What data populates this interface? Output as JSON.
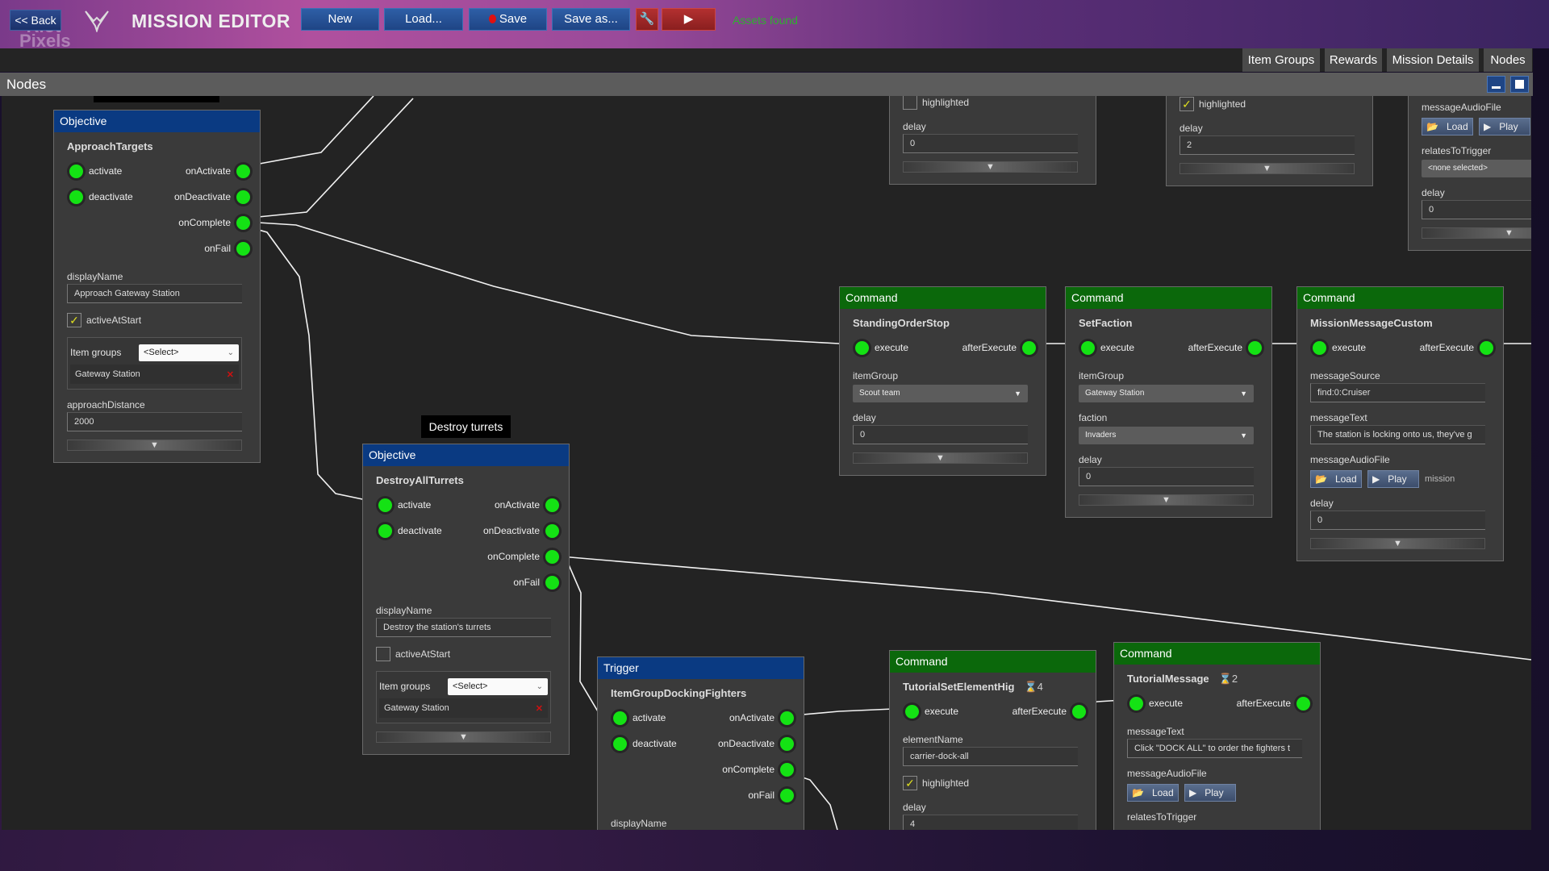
{
  "topbar": {
    "back_label": "<< Back",
    "watermark": "Riot Pixels",
    "title": "MISSION EDITOR",
    "buttons": {
      "new": "New",
      "load": "Load...",
      "save": "Save",
      "save_as": "Save as..."
    },
    "status": "Assets found",
    "status_color": "#2fb02f",
    "icons": {
      "logo": "wings-emblem-icon",
      "tools": "wrench-icon",
      "run": "play-icon",
      "save_dot": "red-dot-icon"
    }
  },
  "tabs": [
    "Item Groups",
    "Rewards",
    "Mission Details",
    "Nodes"
  ],
  "panel": {
    "title": "Nodes"
  },
  "tooltip": "Destroy turrets",
  "colors": {
    "objective_header": "#0a3a82",
    "command_header": "#0b680b",
    "port": "#14e214"
  },
  "nodes": [
    {
      "category": "Objective",
      "name": "ApproachTargets",
      "inputs": [
        "activate",
        "deactivate"
      ],
      "outputs": [
        "onActivate",
        "onDeactivate",
        "onComplete",
        "onFail"
      ],
      "fields": [
        {
          "kind": "text",
          "label": "displayName",
          "value": "Approach Gateway Station"
        },
        {
          "kind": "checkbox",
          "label": "activeAtStart",
          "checked": true
        },
        {
          "kind": "itemgroups",
          "label": "Item groups",
          "select": "<Select>",
          "items": [
            "Gateway Station"
          ]
        },
        {
          "kind": "text",
          "label": "approachDistance",
          "value": "2000"
        },
        {
          "kind": "expand"
        }
      ]
    },
    {
      "category": "Objective",
      "name": "DestroyAllTurrets",
      "inputs": [
        "activate",
        "deactivate"
      ],
      "outputs": [
        "onActivate",
        "onDeactivate",
        "onComplete",
        "onFail"
      ],
      "fields": [
        {
          "kind": "text",
          "label": "displayName",
          "value": "Destroy the station's turrets"
        },
        {
          "kind": "checkbox",
          "label": "activeAtStart",
          "checked": false
        },
        {
          "kind": "itemgroups",
          "label": "Item groups",
          "select": "<Select>",
          "items": [
            "Gateway Station"
          ]
        },
        {
          "kind": "expand"
        }
      ]
    },
    {
      "category": "Trigger",
      "name": "ItemGroupDockingFighters",
      "inputs": [
        "activate",
        "deactivate"
      ],
      "outputs": [
        "onActivate",
        "onDeactivate",
        "onComplete",
        "onFail"
      ],
      "fields": [
        {
          "kind": "label",
          "label": "displayName"
        }
      ]
    },
    {
      "category": "Command",
      "name": "StandingOrderStop",
      "inputs": [
        "execute"
      ],
      "outputs": [
        "afterExecute"
      ],
      "fields": [
        {
          "kind": "select",
          "label": "itemGroup",
          "value": "Scout team"
        },
        {
          "kind": "text",
          "label": "delay",
          "value": "0"
        },
        {
          "kind": "expand"
        }
      ]
    },
    {
      "category": "Command",
      "name": "SetFaction",
      "inputs": [
        "execute"
      ],
      "outputs": [
        "afterExecute"
      ],
      "fields": [
        {
          "kind": "select",
          "label": "itemGroup",
          "value": "Gateway Station"
        },
        {
          "kind": "select",
          "label": "faction",
          "value": "Invaders"
        },
        {
          "kind": "text",
          "label": "delay",
          "value": "0"
        },
        {
          "kind": "expand"
        }
      ]
    },
    {
      "category": "Command",
      "name": "MissionMessageCustom",
      "inputs": [
        "execute"
      ],
      "outputs": [
        "afterExecute"
      ],
      "fields": [
        {
          "kind": "text",
          "label": "messageSource",
          "value": "find:0:Cruiser"
        },
        {
          "kind": "text",
          "label": "messageText",
          "value": "The station is locking onto us, they've g"
        },
        {
          "kind": "audio",
          "label": "messageAudioFile",
          "load": "Load",
          "play": "Play",
          "extra": "mission"
        },
        {
          "kind": "text",
          "label": "delay",
          "value": "0"
        },
        {
          "kind": "expand"
        }
      ]
    },
    {
      "category": "Command",
      "name": "TutorialSetElementHig",
      "badge": "4",
      "inputs": [
        "execute"
      ],
      "outputs": [
        "afterExecute"
      ],
      "fields": [
        {
          "kind": "text",
          "label": "elementName",
          "value": "carrier-dock-all"
        },
        {
          "kind": "checkbox",
          "label": "highlighted",
          "checked": true
        },
        {
          "kind": "text",
          "label": "delay",
          "value": "4"
        }
      ]
    },
    {
      "category": "Command",
      "name": "TutorialMessage",
      "badge": "2",
      "inputs": [
        "execute"
      ],
      "outputs": [
        "afterExecute"
      ],
      "fields": [
        {
          "kind": "text",
          "label": "messageText",
          "value": "Click \"DOCK ALL\" to order the fighters t"
        },
        {
          "kind": "audio",
          "label": "messageAudioFile",
          "load": "Load",
          "play": "Play"
        },
        {
          "kind": "label",
          "label": "relatesToTrigger"
        }
      ]
    },
    {
      "fields": [
        {
          "kind": "checkbox",
          "label": "highlighted",
          "checked": false
        },
        {
          "kind": "text",
          "label": "delay",
          "value": "0"
        },
        {
          "kind": "expand"
        }
      ]
    },
    {
      "fields": [
        {
          "kind": "checkbox",
          "label": "highlighted",
          "checked": true
        },
        {
          "kind": "text",
          "label": "delay",
          "value": "2"
        },
        {
          "kind": "expand"
        }
      ]
    },
    {
      "fields": [
        {
          "kind": "audio",
          "label": "messageAudioFile",
          "load": "Load",
          "play": "Play"
        },
        {
          "kind": "select",
          "label": "relatesToTrigger",
          "value": "<none selected>"
        },
        {
          "kind": "text",
          "label": "delay",
          "value": "0"
        },
        {
          "kind": "expand"
        }
      ]
    }
  ]
}
